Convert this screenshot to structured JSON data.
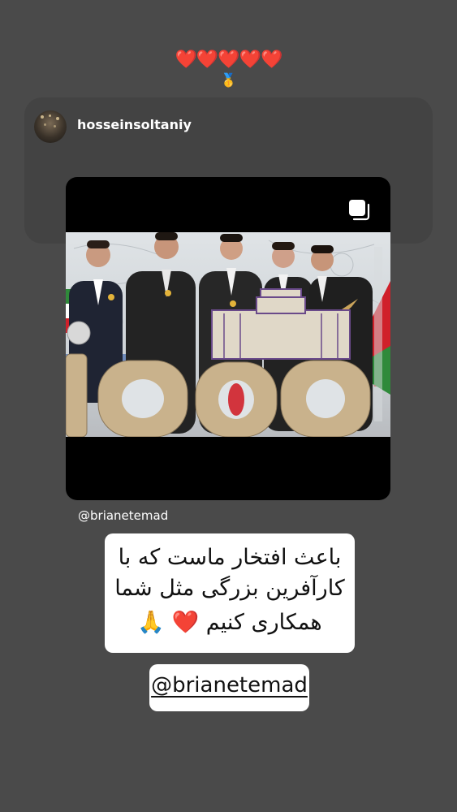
{
  "stickers": {
    "hearts": "❤️❤️❤️❤️❤️",
    "medal": "🥇"
  },
  "repost": {
    "username": "hosseinsoltaniy",
    "multi_icon": "multiple-posts-icon"
  },
  "caption_mention": "@brianetemad",
  "text_sticker": {
    "line1": "باعث افتخار ماست که با",
    "line2": "کارآفرین بزرگی مثل شما",
    "line3_text": "همکاری کنیم",
    "line3_heart": "❤️",
    "line3_hands": "🙏"
  },
  "mention_sticker": "@brianetemad",
  "colors": {
    "background": "#4a4a4a",
    "card": "#434343",
    "heart": "#ff2a3d"
  }
}
